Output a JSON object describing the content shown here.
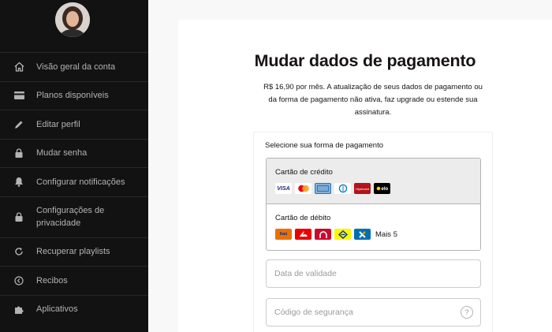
{
  "sidebar": {
    "items": [
      {
        "label": "Visão geral da conta",
        "icon": "home-icon"
      },
      {
        "label": "Planos disponíveis",
        "icon": "card-icon"
      },
      {
        "label": "Editar perfil",
        "icon": "pencil-icon"
      },
      {
        "label": "Mudar senha",
        "icon": "lock-icon"
      },
      {
        "label": "Configurar notificações",
        "icon": "bell-icon"
      },
      {
        "label": "Configurações de privacidade",
        "icon": "lock-icon"
      },
      {
        "label": "Recuperar playlists",
        "icon": "refresh-icon"
      },
      {
        "label": "Recibos",
        "icon": "clock-icon"
      },
      {
        "label": "Aplicativos",
        "icon": "puzzle-icon"
      }
    ]
  },
  "main": {
    "title": "Mudar dados de pagamento",
    "description": "R$ 16,90 por mês. A atualização de seus dados de pagamento ou da forma de pagamento não ativa, faz upgrade ou estende sua assinatura.",
    "payment": {
      "heading": "Selecione sua forma de pagamento",
      "credit": {
        "label": "Cartão de crédito",
        "logos": [
          {
            "text": "VISA",
            "bg": "#ffffff",
            "fg": "#1a1f71"
          },
          {
            "text": "",
            "bg": "#ffffff",
            "fg": "#eb001b"
          },
          {
            "text": "AMEX",
            "bg": "#2e77bb",
            "fg": "#ffffff"
          },
          {
            "text": "D",
            "bg": "#ffffff",
            "fg": "#0079be"
          },
          {
            "text": "Hipercard",
            "bg": "#b3131b",
            "fg": "#ffffff"
          },
          {
            "text": "elo",
            "bg": "#000000",
            "fg": "#ffffff"
          }
        ]
      },
      "debit": {
        "label": "Cartão de débito",
        "more": "Mais 5",
        "logos": [
          {
            "text": "Itaú",
            "bg": "#ec7000",
            "fg": "#003399"
          },
          {
            "text": "S",
            "bg": "#ec0000",
            "fg": "#ffffff"
          },
          {
            "text": "B",
            "bg": "#cc092f",
            "fg": "#ffffff"
          },
          {
            "text": "BB",
            "bg": "#fcf600",
            "fg": "#003399"
          },
          {
            "text": "X",
            "bg": "#0070af",
            "fg": "#ffffff"
          }
        ]
      },
      "expiry_placeholder": "Data de validade",
      "cvv_placeholder": "Código de segurança",
      "help_symbol": "?"
    }
  }
}
